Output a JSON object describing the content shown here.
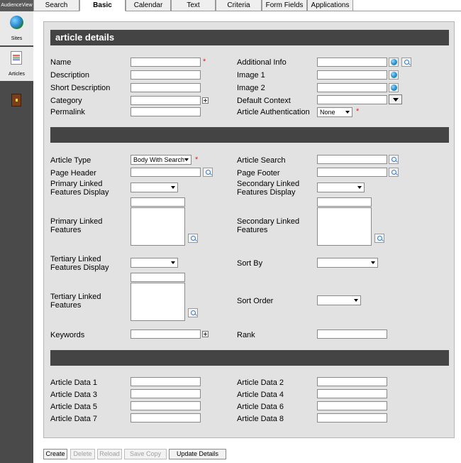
{
  "app": {
    "brand": "AudienceView"
  },
  "tabs": [
    "Search",
    "Basic",
    "Calendar",
    "Text",
    "Criteria",
    "Form Fields",
    "Applications"
  ],
  "sidebar": {
    "items": [
      {
        "label": "Sites",
        "icon": "globe-icon"
      },
      {
        "label": "Articles",
        "icon": "articles-icon"
      },
      {
        "label": "",
        "icon": "book-icon"
      }
    ]
  },
  "section_title": "article details",
  "fields": {
    "name": "Name",
    "description": "Description",
    "short_description": "Short Description",
    "category": "Category",
    "permalink": "Permalink",
    "additional_info": "Additional Info",
    "image1": "Image 1",
    "image2": "Image 2",
    "default_context": "Default Context",
    "article_auth": "Article Authentication",
    "article_auth_value": "None",
    "article_type": "Article Type",
    "article_type_value": "Body With Search",
    "article_search": "Article Search",
    "page_header": "Page Header",
    "page_footer": "Page Footer",
    "primary_lfd": "Primary Linked\nFeatures Display",
    "secondary_lfd": "Secondary Linked\nFeatures Display",
    "primary_lf": "Primary Linked\nFeatures",
    "secondary_lf": "Secondary Linked\nFeatures",
    "tertiary_lfd": "Tertiary Linked\nFeatures Display",
    "sort_by": "Sort By",
    "tertiary_lf": "Tertiary Linked\nFeatures",
    "sort_order": "Sort Order",
    "keywords": "Keywords",
    "rank": "Rank",
    "data1": "Article Data 1",
    "data2": "Article Data 2",
    "data3": "Article Data 3",
    "data4": "Article Data 4",
    "data5": "Article Data 5",
    "data6": "Article Data 6",
    "data7": "Article Data 7",
    "data8": "Article Data 8",
    "required_mark": "*"
  },
  "buttons": {
    "create": "Create",
    "delete": "Delete",
    "reload": "Reload",
    "save_copy": "Save Copy",
    "update": "Update Details"
  }
}
